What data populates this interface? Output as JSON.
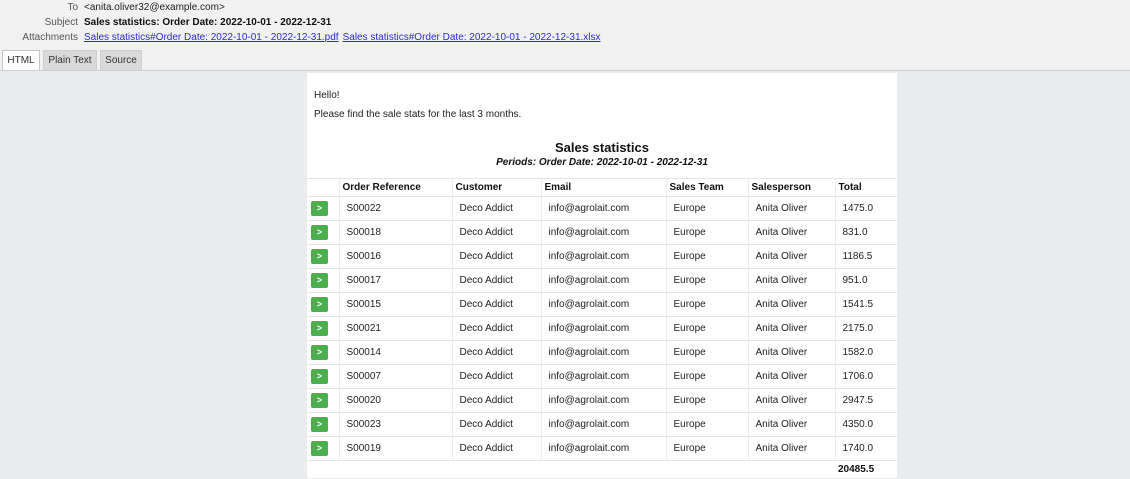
{
  "header": {
    "to_label": "To",
    "to_value": "<anita.oliver32@example.com>",
    "subject_label": "Subject",
    "subject_value": "Sales statistics: Order Date: 2022-10-01 - 2022-12-31",
    "attachments_label": "Attachments",
    "attachments": [
      "Sales statistics#Order Date: 2022-10-01 - 2022-12-31.pdf",
      "Sales statistics#Order Date: 2022-10-01 - 2022-12-31.xlsx"
    ]
  },
  "tabs": [
    {
      "label": "HTML",
      "active": true
    },
    {
      "label": "Plain Text",
      "active": false
    },
    {
      "label": "Source",
      "active": false
    }
  ],
  "email": {
    "greeting": "Hello!",
    "intro": "Please find the sale stats for the last 3 months.",
    "title": "Sales statistics",
    "period": "Periods: Order Date: 2022-10-01 - 2022-12-31",
    "button_label": ">",
    "columns": [
      "Order Reference",
      "Customer",
      "Email",
      "Sales Team",
      "Salesperson",
      "Total"
    ],
    "rows": [
      [
        "S00022",
        "Deco Addict",
        "info@agrolait.com",
        "Europe",
        "Anita Oliver",
        "1475.0"
      ],
      [
        "S00018",
        "Deco Addict",
        "info@agrolait.com",
        "Europe",
        "Anita Oliver",
        "831.0"
      ],
      [
        "S00016",
        "Deco Addict",
        "info@agrolait.com",
        "Europe",
        "Anita Oliver",
        "1186.5"
      ],
      [
        "S00017",
        "Deco Addict",
        "info@agrolait.com",
        "Europe",
        "Anita Oliver",
        "951.0"
      ],
      [
        "S00015",
        "Deco Addict",
        "info@agrolait.com",
        "Europe",
        "Anita Oliver",
        "1541.5"
      ],
      [
        "S00021",
        "Deco Addict",
        "info@agrolait.com",
        "Europe",
        "Anita Oliver",
        "2175.0"
      ],
      [
        "S00014",
        "Deco Addict",
        "info@agrolait.com",
        "Europe",
        "Anita Oliver",
        "1582.0"
      ],
      [
        "S00007",
        "Deco Addict",
        "info@agrolait.com",
        "Europe",
        "Anita Oliver",
        "1706.0"
      ],
      [
        "S00020",
        "Deco Addict",
        "info@agrolait.com",
        "Europe",
        "Anita Oliver",
        "2947.5"
      ],
      [
        "S00023",
        "Deco Addict",
        "info@agrolait.com",
        "Europe",
        "Anita Oliver",
        "4350.0"
      ],
      [
        "S00019",
        "Deco Addict",
        "info@agrolait.com",
        "Europe",
        "Anita Oliver",
        "1740.0"
      ]
    ],
    "total": "20485.5"
  },
  "colors": {
    "button": "#4cae4c",
    "link": "#2b2bd6",
    "background": "#e9ebed"
  }
}
